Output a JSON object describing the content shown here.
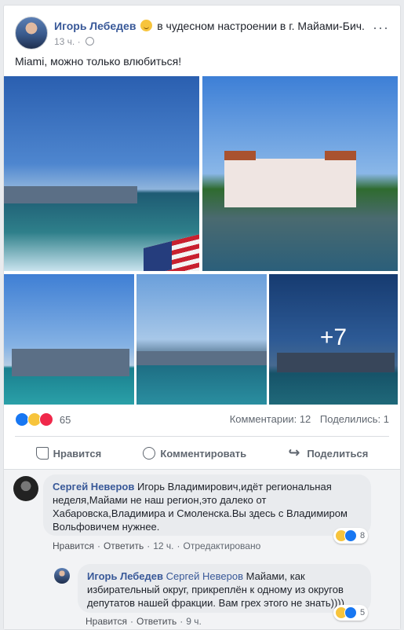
{
  "post": {
    "author": "Игорь Лебедев",
    "feeling": "в чудесном настроении в г. Майами-Бич.",
    "time": "13 ч.",
    "more": "···",
    "text": "Miami, можно только влюбиться!",
    "photo_more": "+7",
    "reactions_count": "65",
    "comments": "Комментарии: 12",
    "shares": "Поделились: 1"
  },
  "actions": {
    "like": "Нравится",
    "comment": "Комментировать",
    "share": "Поделиться"
  },
  "comments": [
    {
      "author": "Сергей Неверов",
      "text": "Игорь Владимирович,идёт региональная неделя,Майами не наш регион,это далеко от Хабаровска,Владимира и Смоленска.Вы здесь с Владимиром Вольфовичем нужнее.",
      "like": "Нравится",
      "reply": "Ответить",
      "time": "12 ч.",
      "edited": "Отредактировано",
      "reactions": "8"
    },
    {
      "author": "Игорь Лебедев",
      "mention": "Сергей Неверов",
      "text": "Майами, как избирательный округ, прикреплён к одному из округов депутатов нашей фракции. Вам грех этого не знать))))",
      "like": "Нравится",
      "reply": "Ответить",
      "time": "9 ч.",
      "reactions": "5"
    }
  ],
  "colors": {
    "link": "#385898",
    "like": "#1877f2",
    "love": "#f0284a",
    "haha": "#f7c43c"
  }
}
